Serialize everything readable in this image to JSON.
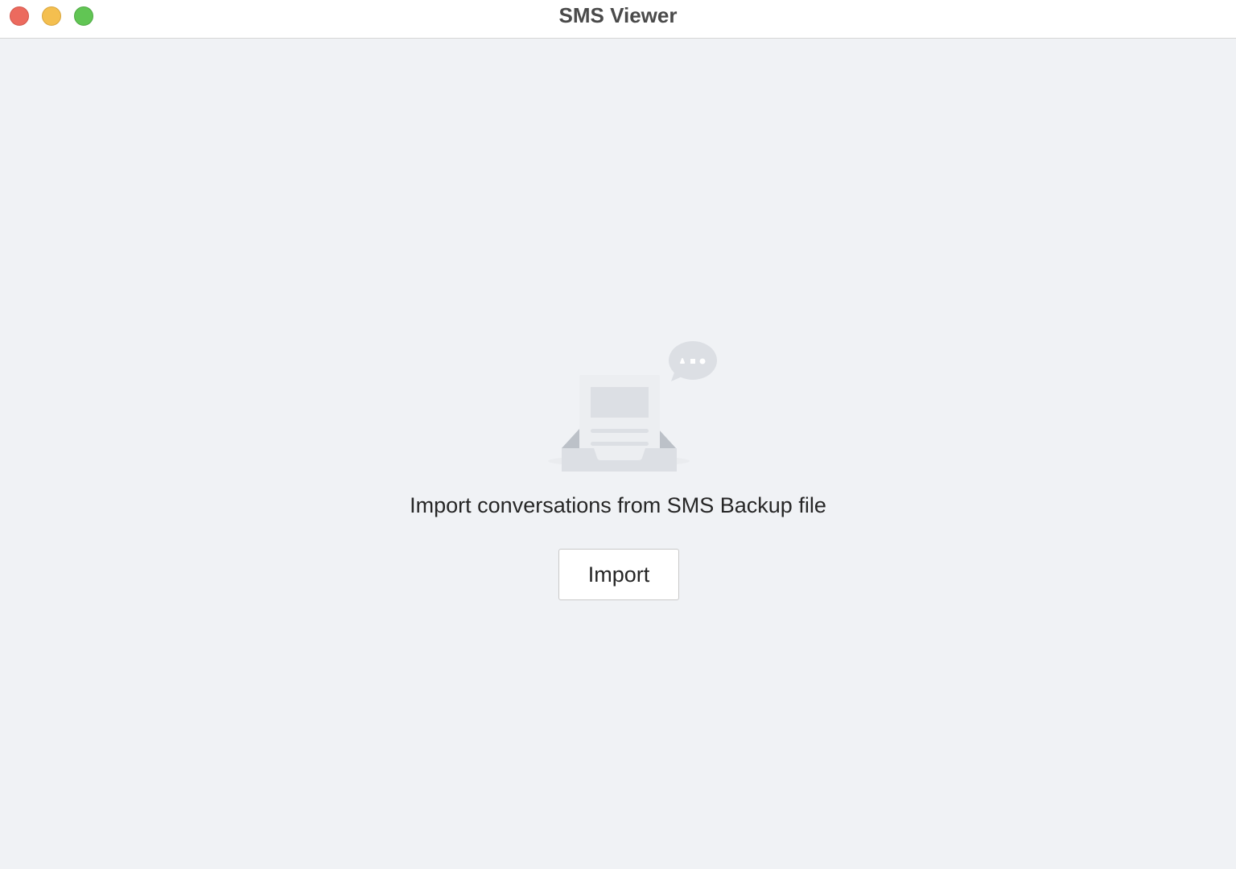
{
  "window": {
    "title": "SMS Viewer",
    "controls": {
      "close": "close-button",
      "minimize": "minimize-button",
      "zoom": "zoom-button"
    }
  },
  "empty_state": {
    "icon": "inbox-document-icon",
    "message": "Import conversations from SMS Backup file",
    "import_label": "Import"
  },
  "colors": {
    "background": "#f0f2f5",
    "titlebar": "#ffffff",
    "close": "#ec6a5e",
    "minimize": "#f4bf4f",
    "zoom": "#61c554",
    "illustration": "#dcdfe4"
  }
}
